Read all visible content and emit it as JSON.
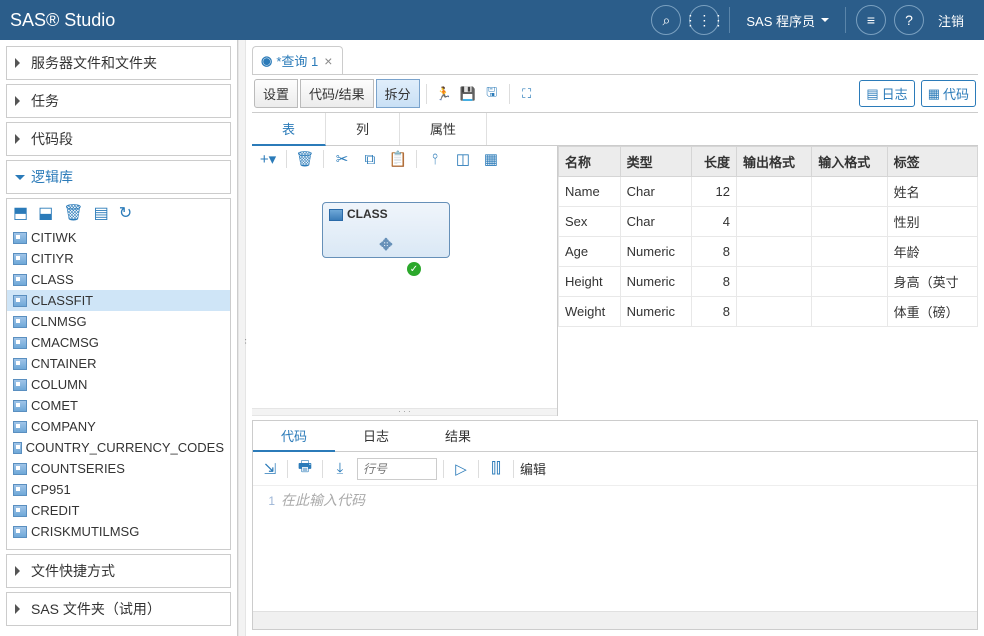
{
  "header": {
    "logo": "SAS® Studio",
    "userLabel": "SAS 程序员",
    "logout": "注销"
  },
  "sidebar": {
    "panels": {
      "files": "服务器文件和文件夹",
      "tasks": "任务",
      "snippets": "代码段",
      "libs": "逻辑库",
      "shortcuts": "文件快捷方式",
      "sasFolders": "SAS 文件夹（试用）"
    },
    "treeItems": [
      "CITIWK",
      "CITIYR",
      "CLASS",
      "CLASSFIT",
      "CLNMSG",
      "CMACMSG",
      "CNTAINER",
      "COLUMN",
      "COMET",
      "COMPANY",
      "COUNTRY_CURRENCY_CODES",
      "COUNTSERIES",
      "CP951",
      "CREDIT",
      "CRISKMUTILMSG"
    ],
    "selected": "CLASSFIT"
  },
  "docTab": {
    "title": "*查询 1"
  },
  "mainToolbar": {
    "settings": "设置",
    "codeResults": "代码/结果",
    "split": "拆分",
    "logBtn": "日志",
    "codeBtn": "代码"
  },
  "subTabs": {
    "table": "表",
    "column": "列",
    "attr": "属性"
  },
  "tableNode": {
    "name": "CLASS"
  },
  "propsHeaders": {
    "name": "名称",
    "type": "类型",
    "length": "长度",
    "outFmt": "输出格式",
    "inFmt": "输入格式",
    "label": "标签"
  },
  "propsRows": [
    {
      "name": "Name",
      "type": "Char",
      "length": "12",
      "label": "姓名"
    },
    {
      "name": "Sex",
      "type": "Char",
      "length": "4",
      "label": "性别"
    },
    {
      "name": "Age",
      "type": "Numeric",
      "length": "8",
      "label": "年龄"
    },
    {
      "name": "Height",
      "type": "Numeric",
      "length": "8",
      "label": "身高（英寸"
    },
    {
      "name": "Weight",
      "type": "Numeric",
      "length": "8",
      "label": "体重（磅）"
    }
  ],
  "codePanel": {
    "tabs": {
      "code": "代码",
      "log": "日志",
      "results": "结果"
    },
    "linePlaceholder": "行号",
    "editBtn": "编辑",
    "lineNum": "1",
    "placeholder": "在此输入代码"
  }
}
